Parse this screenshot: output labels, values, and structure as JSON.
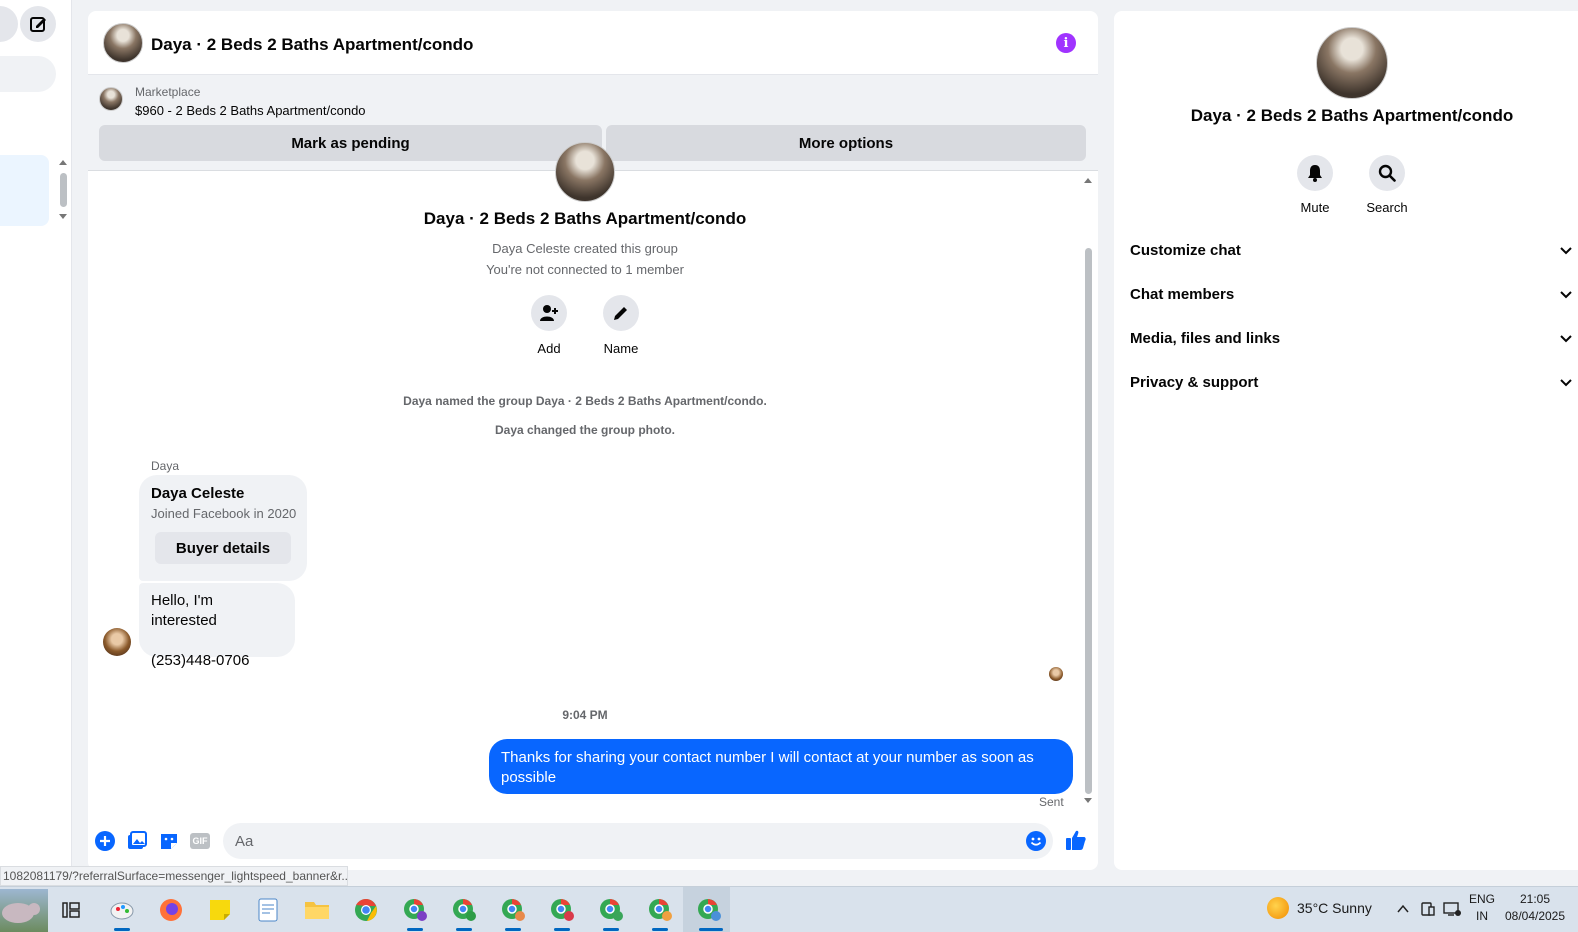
{
  "chat": {
    "title": "Daya · 2 Beds 2 Baths Apartment/condo",
    "marketplace": {
      "label": "Marketplace",
      "listing": "$960 - 2 Beds 2 Baths Apartment/condo",
      "mark_pending": "Mark as pending",
      "more_options": "More options"
    },
    "intro": {
      "title": "Daya · 2 Beds 2 Baths Apartment/condo",
      "created": "Daya Celeste created this group",
      "connected": "You're not connected to 1 member",
      "add_label": "Add",
      "name_label": "Name"
    },
    "system": {
      "named": "Daya named the group Daya · 2 Beds 2 Baths Apartment/condo.",
      "photo": "Daya changed the group photo."
    },
    "buyer": {
      "sender": "Daya",
      "name": "Daya Celeste",
      "joined": "Joined Facebook in 2020",
      "details_button": "Buyer details"
    },
    "incoming": {
      "line1": "Hello, I'm interested",
      "line2": "(253)448-0706"
    },
    "timestamp": "9:04 PM",
    "outgoing": {
      "text": "Thanks for sharing your contact number I will contact at your number as soon as possible",
      "status": "Sent"
    },
    "composer": {
      "placeholder": "Aa",
      "gif_label": "GIF"
    }
  },
  "info_panel": {
    "title": "Daya · 2 Beds 2 Baths Apartment/condo",
    "mute_label": "Mute",
    "search_label": "Search",
    "sections": [
      "Customize chat",
      "Chat members",
      "Media, files and links",
      "Privacy & support"
    ]
  },
  "status_url": "1082081179/?referralSurface=messenger_lightspeed_banner&r...",
  "taskbar": {
    "weather": "35°C  Sunny",
    "lang_top": "ENG",
    "lang_bottom": "IN",
    "time": "21:05",
    "date": "08/04/2025"
  },
  "colors": {
    "accent": "#0866ff",
    "info": "#a033ff"
  }
}
